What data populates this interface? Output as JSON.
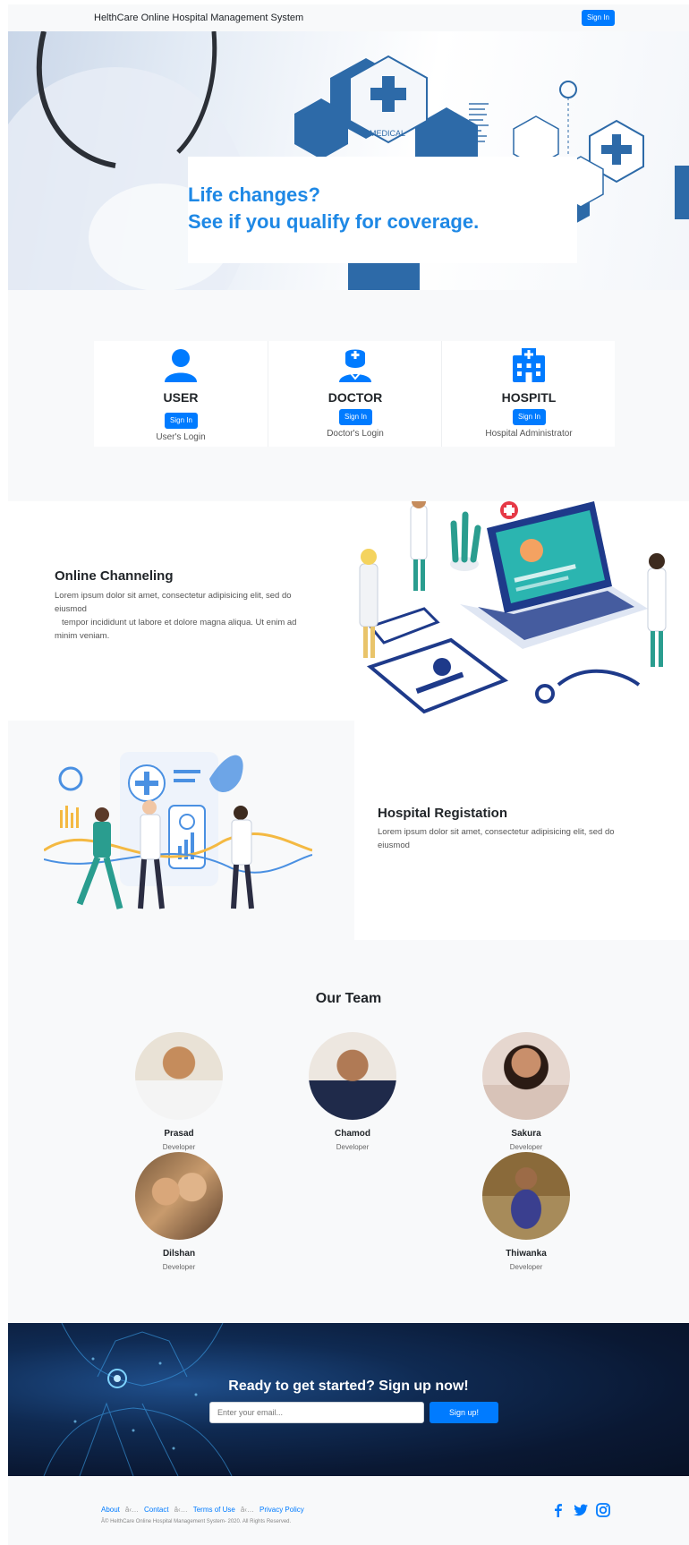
{
  "nav": {
    "brand": "HelthCare Online Hospital Management System",
    "signin_label": "Sign In"
  },
  "hero": {
    "line1": "Life changes?",
    "line2": "See if you qualify for coverage.",
    "badge_text": "MEDICAL"
  },
  "logins": [
    {
      "icon": "user-icon",
      "title": "USER",
      "button": "Sign In",
      "subtitle": "User's Login"
    },
    {
      "icon": "doctor-icon",
      "title": "DOCTOR",
      "button": "Sign In",
      "subtitle": "Doctor's Login"
    },
    {
      "icon": "hospital-icon",
      "title": "HOSPITL",
      "button": "Sign In",
      "subtitle": "Hospital Administrator"
    }
  ],
  "channeling": {
    "title": "Online Channeling",
    "text1": "Lorem ipsum dolor sit amet, consectetur adipisicing elit, sed do eiusmod",
    "text2": "tempor incididunt ut labore et dolore magna aliqua. Ut enim ad minim veniam."
  },
  "registration": {
    "title": "Hospital Registation",
    "text": "Lorem ipsum dolor sit amet, consectetur adipisicing elit, sed do eiusmod"
  },
  "team": {
    "title": "Our Team",
    "members": [
      {
        "name": "Prasad",
        "role": "Developer"
      },
      {
        "name": "Chamod",
        "role": "Developer"
      },
      {
        "name": "Sakura",
        "role": "Developer"
      },
      {
        "name": "Dilshan",
        "role": "Developer"
      },
      {
        "name": "Thiwanka",
        "role": "Developer"
      }
    ]
  },
  "cta": {
    "title": "Ready to get started? Sign up now!",
    "placeholder": "Enter your email...",
    "button": "Sign up!"
  },
  "footer": {
    "links": [
      "About",
      "Contact",
      "Terms of Use",
      "Privacy Policy"
    ],
    "separator": "â‹…",
    "copyright": "Â© HelthCare Online Hospital Management System- 2020. All Rights Reserved.",
    "social": [
      "facebook-icon",
      "twitter-icon",
      "instagram-icon"
    ]
  },
  "colors": {
    "primary": "#007bff",
    "hero_text": "#1e88e5",
    "icon_blue": "#0d6efd",
    "cta_bg": "#0a1833"
  }
}
